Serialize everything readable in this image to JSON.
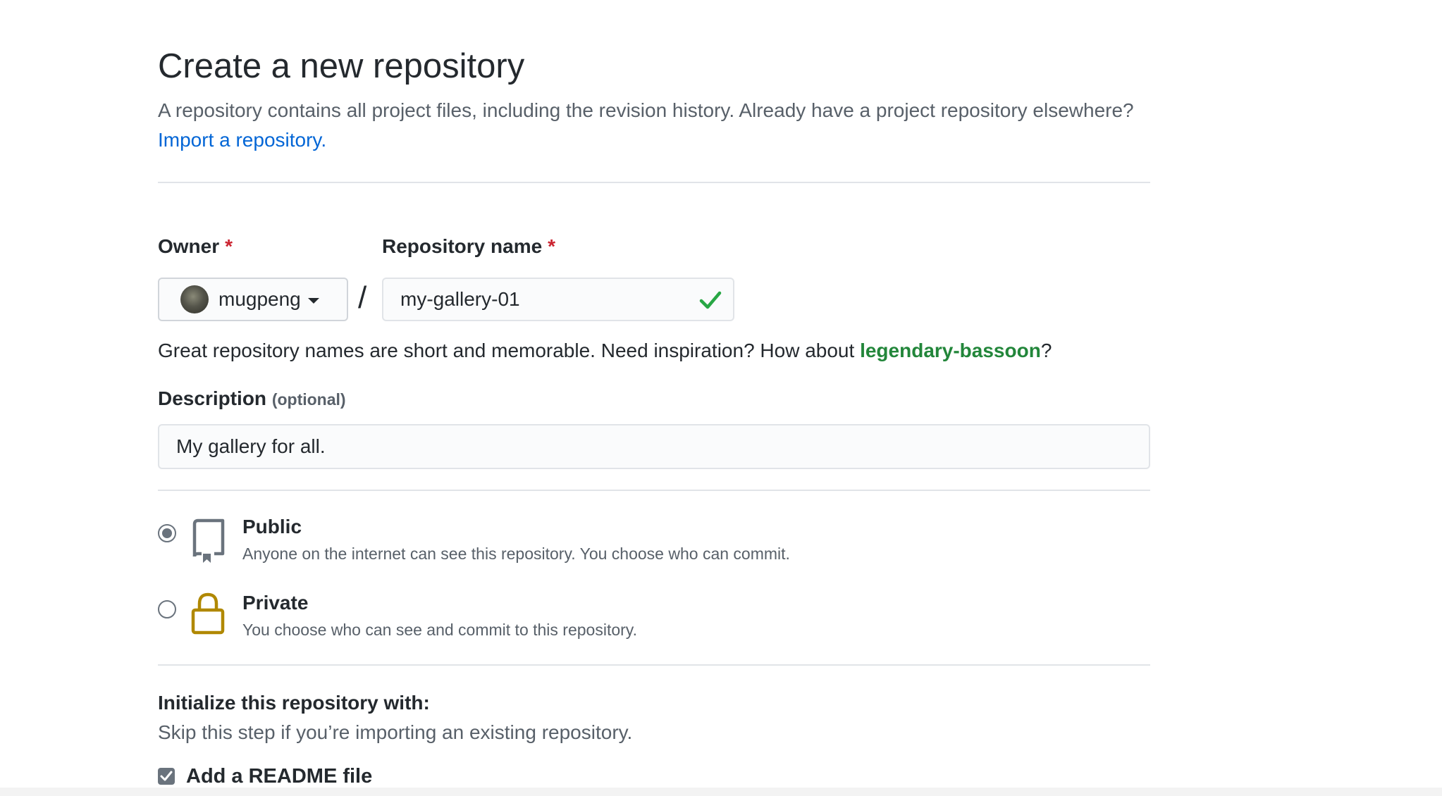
{
  "header": {
    "title": "Create a new repository",
    "intro_text": "A repository contains all project files, including the revision history. Already have a project repository elsewhere?",
    "import_link": "Import a repository."
  },
  "owner": {
    "label": "Owner",
    "required_mark": "*",
    "value": "mugpeng"
  },
  "separator": "/",
  "repository_name": {
    "label": "Repository name",
    "required_mark": "*",
    "value": "my-gallery-01",
    "status_icon": "check-icon",
    "status_color": "#28a745"
  },
  "name_hint": {
    "text": "Great repository names are short and memorable. Need inspiration? How about",
    "suggestion": "legendary-bassoon",
    "suffix": "?"
  },
  "description": {
    "label": "Description",
    "optional": "(optional)",
    "value": "My gallery for all."
  },
  "visibility": {
    "options": [
      {
        "title": "Public",
        "description": "Anyone on the internet can see this repository. You choose who can commit.",
        "icon": "repo-icon",
        "selected": true
      },
      {
        "title": "Private",
        "description": "You choose who can see and commit to this repository.",
        "icon": "lock-icon",
        "icon_color": "#b08800",
        "selected": false
      }
    ]
  },
  "initialize": {
    "title": "Initialize this repository with:",
    "subtitle": "Skip this step if you’re importing an existing repository.",
    "readme_label": "Add a README file",
    "readme_checked": true
  },
  "colors": {
    "link": "#0366d6",
    "required": "#cb2431",
    "suggestion": "#22863a"
  }
}
